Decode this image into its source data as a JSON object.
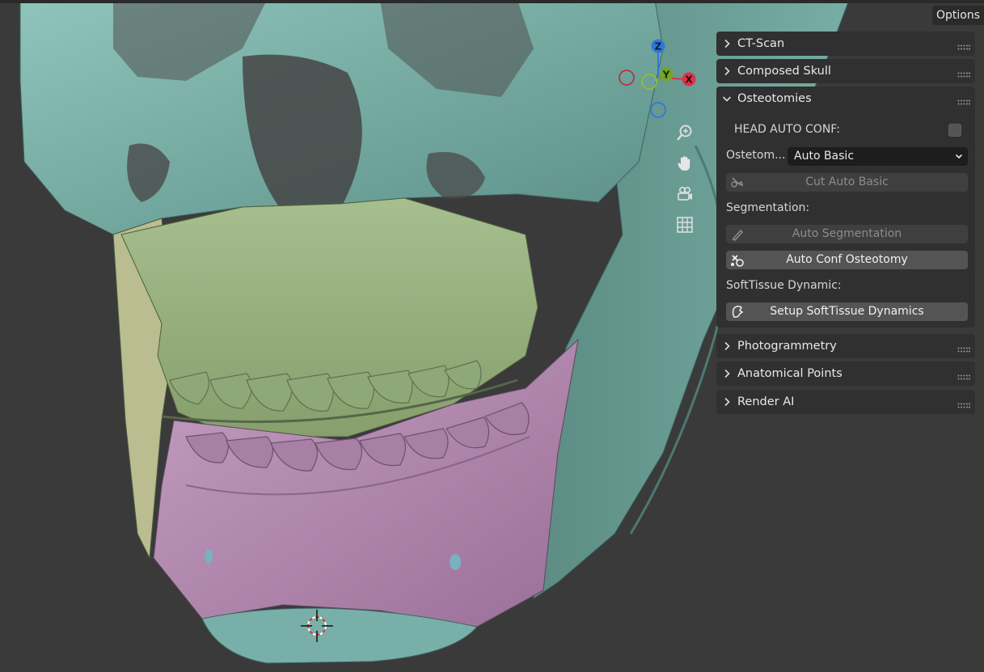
{
  "toolbar": {
    "options_label": "Options"
  },
  "gizmo": {
    "axes": [
      {
        "label": "Z",
        "color": "#2f77d9"
      },
      {
        "label": "Y",
        "color": "#72a52a"
      },
      {
        "label": "X",
        "color": "#d8334a"
      }
    ]
  },
  "nav_icons": [
    "zoom-icon",
    "hand-pan-icon",
    "camera-icon",
    "grid-icon"
  ],
  "panels": {
    "ct_scan": {
      "label": "CT-Scan"
    },
    "composed_skull": {
      "label": "Composed Skull"
    },
    "osteotomies": {
      "label": "Osteotomies",
      "head_auto_conf_label": "HEAD AUTO CONF:",
      "head_auto_conf_checked": false,
      "osteotomy_label": "Ostetom...",
      "osteotomy_value": "Auto Basic",
      "cut_button": "Cut Auto Basic",
      "segmentation_label": "Segmentation:",
      "auto_segmentation_button": "Auto Segmentation",
      "auto_conf_button": "Auto Conf Osteotomy",
      "softtissue_label": "SoftTissue Dynamic:",
      "setup_softtissue_button": "Setup SoftTissue Dynamics"
    },
    "photogrammetry": {
      "label": "Photogrammetry"
    },
    "anatomical_points": {
      "label": "Anatomical Points"
    },
    "render_ai": {
      "label": "Render AI"
    }
  },
  "colors": {
    "viewport_bg": "#3a3a3a",
    "skull_teal": "#77ada4",
    "maxilla_green": "#9db585",
    "mandible_pink": "#b98bb6",
    "panel_bg": "#303030",
    "button_bg": "#545454"
  }
}
